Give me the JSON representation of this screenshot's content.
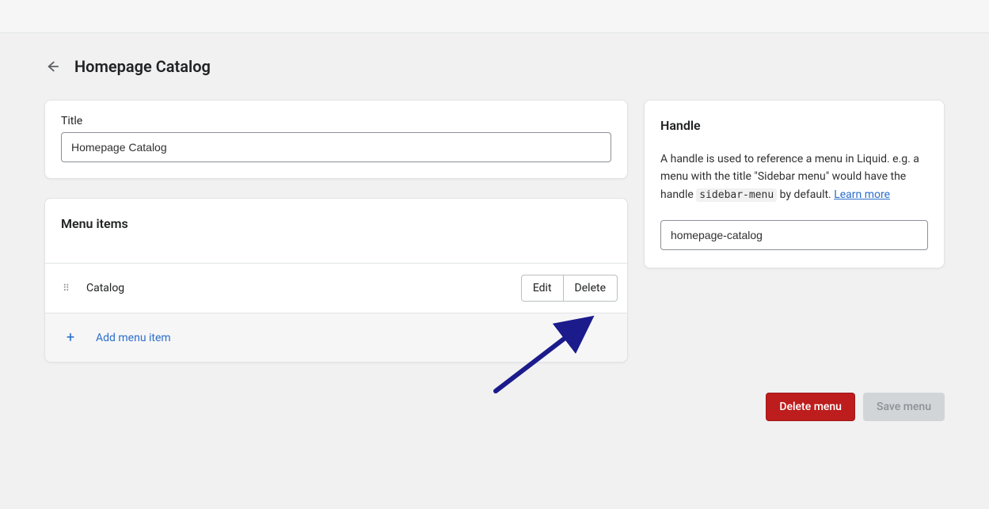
{
  "header": {
    "title": "Homepage Catalog"
  },
  "title_card": {
    "label": "Title",
    "value": "Homepage Catalog"
  },
  "menu_items": {
    "heading": "Menu items",
    "items": [
      {
        "label": "Catalog",
        "edit": "Edit",
        "delete": "Delete"
      }
    ],
    "add_label": "Add menu item"
  },
  "handle_card": {
    "heading": "Handle",
    "desc_before": "A handle is used to reference a menu in Liquid. e.g. a menu with the title \"Sidebar menu\" would have the handle ",
    "code": "sidebar-menu",
    "desc_after": " by default. ",
    "learn_more": "Learn more",
    "value": "homepage-catalog"
  },
  "footer": {
    "delete_label": "Delete menu",
    "save_label": "Save menu"
  }
}
